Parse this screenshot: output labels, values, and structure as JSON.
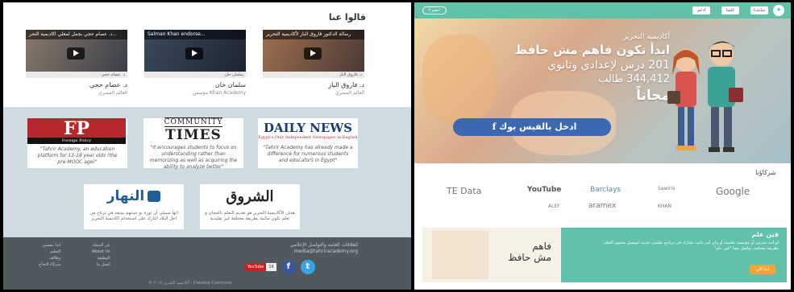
{
  "testimonials": {
    "title": "قالوا عنا",
    "videos": [
      {
        "title": "د. عصام حجي بجمل لمعلي اكاديمية التحر...",
        "caption": "د. عصام حجي",
        "name": "د. عصام حجي",
        "role": "العالم المصري"
      },
      {
        "title": "Salman Khan endorse...",
        "caption": "سلمان خان",
        "name": "سلمان خان",
        "role": "مؤسس Khan Academy"
      },
      {
        "title": "رسالة الدكتور فاروق الباز لأكاديمية التحرير",
        "caption": "د. فاروق الباز",
        "name": "د. فاروق الباز",
        "role": "العالم المصري"
      }
    ]
  },
  "press": {
    "fp": {
      "logo": "FP",
      "sub": "Foreign Policy",
      "quote": "\"Tahrir Academy, an education platform for 13-18 year olds (the pre-MOOC age)\""
    },
    "community_times": {
      "logo_a": "COMMUNITY",
      "logo_b": "TIMES",
      "quote": "\"It encourages students to focus on understanding rather than memorizing as well as acquiring the ability to analyze better\""
    },
    "daily_news": {
      "logo_a": "DAILY NEWS",
      "logo_b": "Egypt's Only Independent Newspaper in English",
      "quote": "\"Tahrir Academy has already made a difference for numerous students and educators in Egypt\""
    },
    "nahar": {
      "logo": "النهار",
      "quote": "انها سبيلي أن ثورة بو حيننهم بيتبعد في ترتاح من اجل البلاد اثتارك على استخدام اكاديمية التحرير"
    },
    "shorouk": {
      "logo": "الشروق",
      "quote": "هدف الأكاديمية التحرير هو تقديم التعلم بالمجان و تعلم تكون مكتبة بطريقة مختلفة غير تقليدية"
    }
  },
  "footer": {
    "links1": [
      "ابدأ بنفسي",
      "التعليم",
      "وظائف",
      "شركاء النجاح"
    ],
    "links2": [
      "عن المجلة",
      "About Us",
      "الوظيفة",
      "اتصل بنا"
    ],
    "contact_title": "للعلاقات العامة والتواصل الإعلامي",
    "contact_email": "media@tahriracademy.org",
    "youtube_label": "YouTube",
    "youtube_count": "1K",
    "copyright": "© أكاديمية التحرير ٢٠١٥ · Creative Commons"
  },
  "topbar": {
    "logo": "✦",
    "buttons": [
      "ساعدنا",
      "كلمنا",
      "ادعم"
    ],
    "fb_button": "f انضم"
  },
  "hero": {
    "line1": "أكاديمية التحرير",
    "line2": "ابدأ تكون فاهم مش حافظ",
    "line3": "201 درس لإعدادي وثانوي",
    "line4": "344,412 طالب",
    "line5": "مجاناً",
    "fb_login": "ادخل بالفيس بوك",
    "fb_icon": "f"
  },
  "partners": {
    "title": "شركاؤنا",
    "logos": [
      "TE Data",
      "YouTube",
      "Barclays",
      "Sawiris",
      "Google",
      "ALEF",
      "aramex",
      "KHAN"
    ]
  },
  "cta": {
    "brand_line1": "فاهم",
    "brand_line2": "مش حافظ",
    "title": "فين علم",
    "text": "لو انت مدرس أو مؤسسة تعليمية أو ولي أمر حابب تشارك في برنامج تعليمي حديث لتوصيل محتوى التعلم بطريقة مختلفة، تواصل معنا \"فين علم\"",
    "button": "ابدأ الآن"
  },
  "colors": {
    "accent": "#62c1a9",
    "facebook": "#3b68b0",
    "press_bg": "#cfdde2",
    "footer_bg": "#505a5e"
  }
}
